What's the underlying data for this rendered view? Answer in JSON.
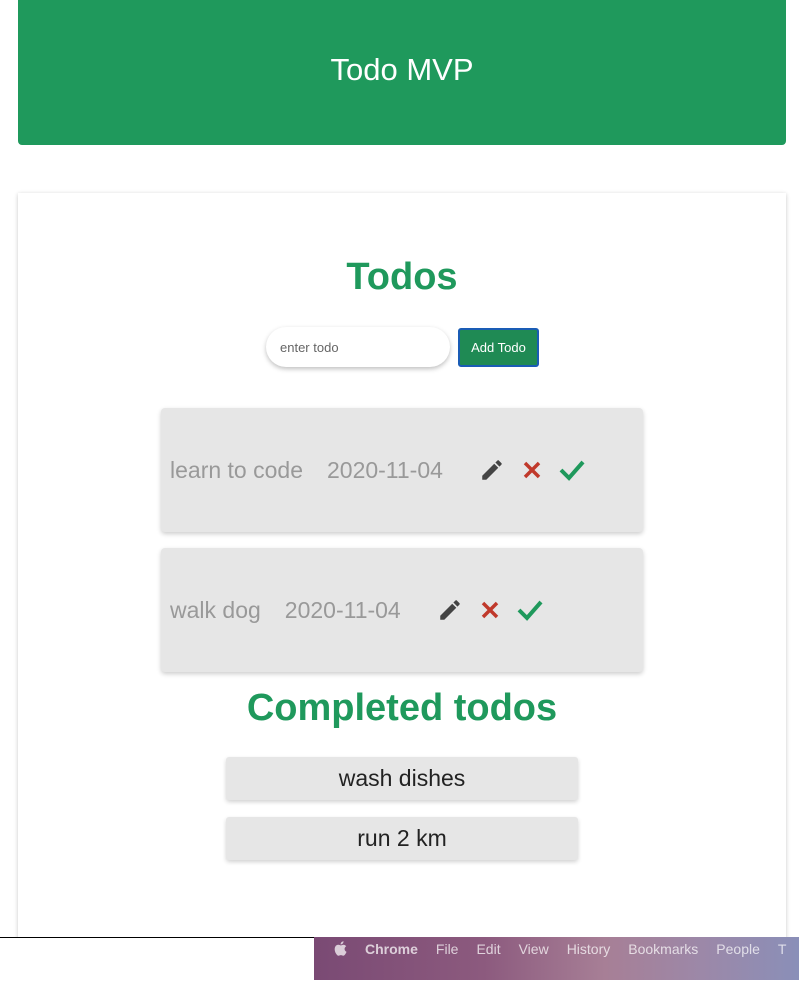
{
  "header": {
    "title": "Todo MVP"
  },
  "todos": {
    "title": "Todos",
    "input_placeholder": "enter todo",
    "add_label": "Add Todo",
    "items": [
      {
        "text": "learn to code",
        "date": "2020-11-04"
      },
      {
        "text": "walk dog",
        "date": "2020-11-04"
      }
    ]
  },
  "completed": {
    "title": "Completed todos",
    "items": [
      {
        "text": "wash dishes"
      },
      {
        "text": "run 2 km"
      }
    ]
  },
  "menubar": {
    "items": [
      "Chrome",
      "File",
      "Edit",
      "View",
      "History",
      "Bookmarks",
      "People",
      "T"
    ]
  },
  "colors": {
    "accent": "#1f995c",
    "edit_icon": "#444444",
    "delete_icon": "#c0392b",
    "complete_icon": "#1f995c",
    "item_bg": "#e6e6e6"
  },
  "icons": [
    "pencil-icon",
    "close-icon",
    "check-icon",
    "apple-icon"
  ]
}
